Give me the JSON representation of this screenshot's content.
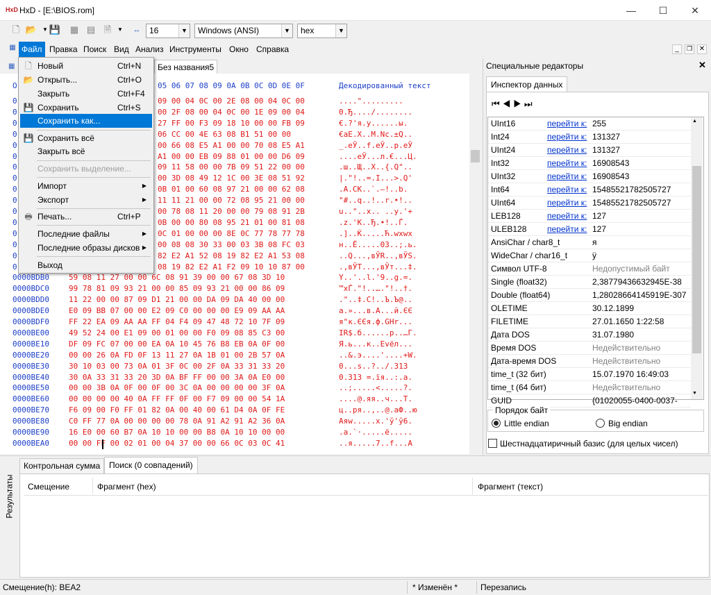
{
  "window": {
    "title": "HxD - [E:\\BIOS.rom]",
    "app_icon_text": "HxD"
  },
  "toolbar": {
    "bytes_per_row": "16",
    "charset": "Windows (ANSI)",
    "offset_base": "hex"
  },
  "menu": {
    "items": [
      "Файл",
      "Правка",
      "Поиск",
      "Вид",
      "Анализ",
      "Инструменты",
      "Окно",
      "Справка"
    ]
  },
  "file_menu": {
    "new": {
      "label": "Новый",
      "shortcut": "Ctrl+N"
    },
    "open": {
      "label": "Открыть...",
      "shortcut": "Ctrl+O"
    },
    "close": {
      "label": "Закрыть",
      "shortcut": "Ctrl+F4"
    },
    "save": {
      "label": "Сохранить",
      "shortcut": "Ctrl+S"
    },
    "save_as": {
      "label": "Сохранить как..."
    },
    "save_all": {
      "label": "Сохранить всё"
    },
    "close_all": {
      "label": "Закрыть всё"
    },
    "save_selection": {
      "label": "Сохранить выделение..."
    },
    "import": {
      "label": "Импорт"
    },
    "export": {
      "label": "Экспорт"
    },
    "print": {
      "label": "Печать...",
      "shortcut": "Ctrl+P"
    },
    "recent_files": {
      "label": "Последние файлы"
    },
    "recent_disks": {
      "label": "Последние образы дисков"
    },
    "exit": {
      "label": "Выход"
    }
  },
  "doc_tabs": {
    "tab2": "Без названия5"
  },
  "hex_view": {
    "header_offset_prefix": "O",
    "header_columns": "05 06 07 08 09 0A 0B 0C 0D 0E 0F",
    "header_decoded": "Декодированный текст",
    "rows": [
      {
        "off": "0",
        "hex": "09 00 04 0C 00 2E 08 00 04 0C 00",
        "txt": "....\"........."
      },
      {
        "off": "0",
        "hex": "00 2F 08 00 04 0C 00 1E 09 00 04",
        "txt": "0.Ђ..../........"
      },
      {
        "off": "0",
        "hex": "27 FF 00 F3 09 18 10 00 00 FB 09",
        "txt": "€.?'я.у......ы."
      },
      {
        "off": "0",
        "hex": "06 CC 00 4E 63 08 B1 51 00 00",
        "txt": "€aE.X..M.Nc.±Q.."
      },
      {
        "off": "0",
        "hex": "00 66 08 E5 A1 00 00 70 08 E5 A1",
        "txt": "_.eЎ..f.eЎ..p.eЎ"
      },
      {
        "off": "0",
        "hex": "A1 00 00 EB 09 88 01 00 00 D6 09",
        "txt": "....eЎ...л.€...Ц."
      },
      {
        "off": "0",
        "hex": "09 11 58 00 00 7B 09 51 22 00 00",
        "txt": ".ш..Щ..X..{.Q\".."
      },
      {
        "off": "0",
        "hex": "00 3D 08 49 12 1C 00 3E 08 51 92",
        "txt": "|.\"!..=.I...>.Q'"
      },
      {
        "off": "0",
        "hex": "0B 01 00 60 08 97 21 00 00 62 08",
        "txt": ".A.CK..`.—!..b."
      },
      {
        "off": "0",
        "hex": "11 11 21 00 00 72 08 95 21 00 00",
        "txt": "\"#..q..!..r.•!.."
      },
      {
        "off": "0",
        "hex": "00 78 08 11 20 00 00 79 08 91 2B",
        "txt": "u..\"..x.. ..y.'+"
      },
      {
        "off": "0",
        "hex": "0B 00 00 80 08 95 21 01 00 81 08",
        "txt": ".z.'К..Ђ.•!..Ѓ."
      },
      {
        "off": "0",
        "hex": "0C 01 00 00 00 8E 0C 77 78 77 78",
        "txt": ".]..Ќ.....Ћ.wxwx"
      },
      {
        "off": "0",
        "hex": "00 08 08 30 33 00 03 3B 08 FC 03",
        "txt": "н..Ё.....03..;.ь."
      },
      {
        "off": "0",
        "hex": "82 E2 A1 52 08 19 82 E2 A1 53 08",
        "txt": "..Q...,вЎR..,вЎS."
      },
      {
        "off": "0",
        "hex": "08 19 82 E2 A1 F2 09 10 10 87 00",
        "txt": ".,вЎТ...,вЎт...‡."
      },
      {
        "off": "0000BDB0",
        "hex": "59 08 11 27 00 00 6C 08 91 39 00 00 67 08 3D 10",
        "txt": "Y..'..l.'9..g.=."
      },
      {
        "off": "0000BDC0",
        "hex": "99 78 81 09 93 21 00 00 85 09 93 21 00 00 86 09",
        "txt": "™xЃ.\"!..….\"!..†."
      },
      {
        "off": "0000BDD0",
        "hex": "11 22 00 00 87 09 D1 21 00 00 DA 09 DA 40 00 00",
        "txt": ".\"..‡.С!..Ъ.Ъ@.."
      },
      {
        "off": "0000BDE0",
        "hex": "E0 09 BB 07 00 00 E2 09 C0 00 00 00 E9 09 AA AA",
        "txt": "а.»...в.А...й.ЄЄ"
      },
      {
        "off": "0000BDF0",
        "hex": "FF 22 EA 09 AA AA FF 04 F4 09 47 48 72 10 7F 09",
        "txt": "я\"к.ЄЄя.ф.GHr..."
      },
      {
        "off": "0000BE00",
        "hex": "49 52 24 00 E1 09 00 01 00 00 F0 09 08 85 C3 00",
        "txt": "IR$.б......р..…Г."
      },
      {
        "off": "0000BE10",
        "hex": "DF 09 FC 07 00 00 EA 0A 10 45 76 B8 EB 0A 0F 00",
        "txt": "Я.ь...к..Evёл..."
      },
      {
        "off": "0000BE20",
        "hex": "00 00 26 0A FD 0F 13 11 27 0A 1B 01 00 2B 57 0A",
        "txt": "..&.э....'....+W."
      },
      {
        "off": "0000BE30",
        "hex": "30 10 03 00 73 0A 01 3F 0C 00 2F 0A 33 31 33 20",
        "txt": "0...s..?../.313 "
      },
      {
        "off": "0000BE40",
        "hex": "30 0A 33 31 33 20 3D 0A BF FF 00 00 3A 0A E0 00",
        "txt": "0.313 =.їя..:.а."
      },
      {
        "off": "0000BE50",
        "hex": "00 00 3B 0A 0F 00 0F 00 3C 0A 00 00 00 00 3F 0A",
        "txt": "..;.....<.....?."
      },
      {
        "off": "0000BE60",
        "hex": "00 00 00 00 40 0A FF FF 0F 00 F7 09 00 00 54 1A",
        "txt": "....@.яя..ч...T."
      },
      {
        "off": "0000BE70",
        "hex": "F6 09 00 F0 FF 01 82 0A 00 40 00 61 D4 0A 0F FE",
        "txt": "ц..ря..‚..@.aФ..ю"
      },
      {
        "off": "0000BE80",
        "hex": "C0 FF 77 0A 00 00 00 00 78 0A 91 A2 91 A2 36 0A",
        "txt": "Аяw.....x.'ў'ў6."
      },
      {
        "off": "0000BE90",
        "hex": "16 E0 00 60 B7 0A 10 10 00 00 B8 0A 10 10 00 00",
        "txt": ".а.`·.....ё....."
      },
      {
        "off": "0000BEA0",
        "hex": "00 00 FF 00 02 01 00 04 37 00 00 66 0C 03 0C 41",
        "txt": "..я.....7..f...A"
      }
    ]
  },
  "special_editors": {
    "title": "Специальные редакторы",
    "tab": "Инспектор данных"
  },
  "inspector": {
    "link_text": "перейти к:",
    "rows": [
      {
        "name": "UInt16",
        "value": "255",
        "link": true
      },
      {
        "name": "Int24",
        "value": "131327",
        "link": true
      },
      {
        "name": "UInt24",
        "value": "131327",
        "link": true
      },
      {
        "name": "Int32",
        "value": "16908543",
        "link": true
      },
      {
        "name": "UInt32",
        "value": "16908543",
        "link": true
      },
      {
        "name": "Int64",
        "value": "15485521782505727",
        "link": true
      },
      {
        "name": "UInt64",
        "value": "15485521782505727",
        "link": true
      },
      {
        "name": "LEB128",
        "value": "127",
        "link": true
      },
      {
        "name": "ULEB128",
        "value": "127",
        "link": true
      },
      {
        "name": "AnsiChar / char8_t",
        "value": "я",
        "link": false
      },
      {
        "name": "WideChar / char16_t",
        "value": "ÿ",
        "link": false
      },
      {
        "name": "Символ UTF-8",
        "value": "Недопустимый байт",
        "link": false,
        "gray": true
      },
      {
        "name": "Single (float32)",
        "value": "2,38779436632945E-38",
        "link": false
      },
      {
        "name": "Double (float64)",
        "value": "1,28028664145919E-307",
        "link": false
      },
      {
        "name": "OLETIME",
        "value": "30.12.1899",
        "link": false
      },
      {
        "name": "FILETIME",
        "value": "27.01.1650 1:22:58",
        "link": false
      },
      {
        "name": "Дата DOS",
        "value": "31.07.1980",
        "link": false
      },
      {
        "name": "Время DOS",
        "value": "Недействительно",
        "link": false,
        "gray": true
      },
      {
        "name": "Дата-время DOS",
        "value": "Недействительно",
        "link": false,
        "gray": true
      },
      {
        "name": "time_t (32 бит)",
        "value": "15.07.1970 16:49:03",
        "link": false
      },
      {
        "name": "time_t (64 бит)",
        "value": "Недействительно",
        "link": false,
        "gray": true
      },
      {
        "name": "GUID",
        "value": "{01020055-0400-0037-0066",
        "link": false
      }
    ],
    "byte_order_label": "Порядок байт",
    "little_endian": "Little endian",
    "big_endian": "Big endian",
    "hex_basis": "Шестнадцатиричный базис (для целых чисел)"
  },
  "results": {
    "side_label": "Результаты",
    "tab_checksum": "Контрольная сумма",
    "tab_search": "Поиск (0 совпадений)",
    "col_offset": "Смещение",
    "col_hex": "Фрагмент (hex)",
    "col_text": "Фрагмент (текст)"
  },
  "status": {
    "offset": "Смещение(h): BEA2",
    "modified": "* Изменён *",
    "mode": "Перезапись"
  }
}
